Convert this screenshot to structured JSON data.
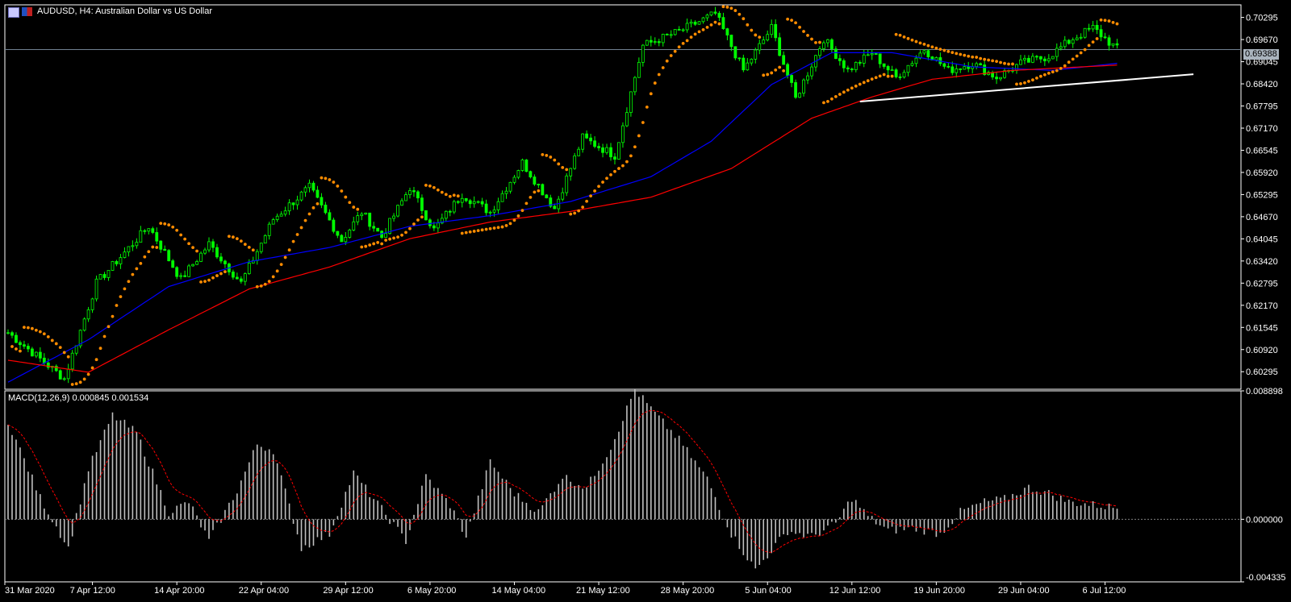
{
  "header": {
    "symbol_line": "AUDUSD, H4:  Australian Dollar vs US Dollar",
    "icons": [
      "chart-window-icon",
      "flag-icon"
    ]
  },
  "macd_label": "MACD(12,26,9) 0.000845 0.001534",
  "current_price": "0.69388",
  "colors": {
    "background": "#000000",
    "grid": "#ffffff",
    "candle_up": "#00ff00",
    "candle_down": "#00ff00",
    "ma_fast": "#0000ff",
    "ma_slow": "#ff0000",
    "sar": "#ff8c00",
    "trendline": "#ffffff",
    "macd_hist": "#c0c0c0",
    "macd_signal": "#ff0000",
    "price_line": "#708090"
  },
  "chart_data": [
    {
      "type": "candlestick",
      "title": "AUDUSD, H4:  Australian Dollar vs US Dollar",
      "ylim": [
        0.598,
        0.7065
      ],
      "y_ticks": [
        "0.70295",
        "0.69670",
        "0.69045",
        "0.68420",
        "0.67795",
        "0.67170",
        "0.66545",
        "0.65920",
        "0.65295",
        "0.64670",
        "0.64045",
        "0.63420",
        "0.62795",
        "0.62170",
        "0.61545",
        "0.60920",
        "0.60295"
      ],
      "x_ticks": [
        "31 Mar 2020",
        "7 Apr 12:00",
        "14 Apr 20:00",
        "22 Apr 04:00",
        "29 Apr 12:00",
        "6 May 20:00",
        "14 May 04:00",
        "21 May 12:00",
        "28 May 20:00",
        "5 Jun 04:00",
        "12 Jun 12:00",
        "19 Jun 20:00",
        "29 Jun 04:00",
        "6 Jul 12:00"
      ],
      "bars": 277,
      "close_path_anchors": {
        "bar_index": [
          0,
          14,
          22,
          35,
          43,
          50,
          58,
          66,
          75,
          83,
          88,
          93,
          100,
          106,
          113,
          120,
          128,
          136,
          143,
          151,
          158,
          167,
          176,
          183,
          190,
          196,
          203,
          209,
          215,
          221,
          228,
          234,
          240,
          246,
          252,
          259,
          265,
          270,
          276
        ],
        "close": [
          0.614,
          0.601,
          0.628,
          0.644,
          0.629,
          0.639,
          0.628,
          0.646,
          0.655,
          0.64,
          0.648,
          0.641,
          0.655,
          0.643,
          0.653,
          0.648,
          0.662,
          0.649,
          0.669,
          0.664,
          0.695,
          0.699,
          0.704,
          0.688,
          0.7,
          0.68,
          0.697,
          0.688,
          0.693,
          0.686,
          0.694,
          0.688,
          0.69,
          0.686,
          0.69,
          0.692,
          0.697,
          0.7,
          0.694
        ]
      },
      "ma_fast_anchors": {
        "bar_index": [
          0,
          20,
          40,
          60,
          80,
          100,
          120,
          140,
          160,
          175,
          190,
          205,
          220,
          240,
          260,
          276
        ],
        "value": [
          0.6,
          0.612,
          0.627,
          0.634,
          0.638,
          0.644,
          0.647,
          0.651,
          0.658,
          0.668,
          0.684,
          0.693,
          0.693,
          0.689,
          0.688,
          0.69
        ]
      },
      "ma_slow_anchors": {
        "bar_index": [
          0,
          20,
          40,
          60,
          80,
          100,
          120,
          140,
          160,
          180,
          200,
          215,
          230,
          250,
          276
        ],
        "value": [
          0.6062,
          0.6028,
          0.6148,
          0.6263,
          0.6325,
          0.6405,
          0.6452,
          0.6482,
          0.6522,
          0.6603,
          0.6745,
          0.6805,
          0.6855,
          0.688,
          0.6895
        ]
      },
      "trendline": {
        "from": {
          "bar": 212,
          "price": 0.6792
        },
        "to": {
          "bar": 295,
          "price": 0.6869
        }
      },
      "sar_note": "Parabolic SAR dots plotted above and below price"
    },
    {
      "type": "bar",
      "title": "MACD(12,26,9) 0.000845 0.001534",
      "ylim": [
        -0.004335,
        0.008898
      ],
      "y_ticks": [
        "0.008898",
        "0.000000",
        "-0.004335"
      ],
      "macd_values": 0.000845,
      "signal_value": 0.001534,
      "hist_anchors": {
        "bar_index": [
          0,
          8,
          15,
          20,
          26,
          32,
          40,
          45,
          50,
          57,
          62,
          66,
          73,
          80,
          86,
          93,
          99,
          104,
          110,
          114,
          120,
          126,
          132,
          138,
          144,
          150,
          156,
          162,
          167,
          174,
          180,
          186,
          194,
          200,
          206,
          210,
          214,
          219,
          225,
          232,
          237,
          243,
          248,
          254,
          259,
          264,
          270,
          276
        ],
        "value": [
          0.0068,
          0.0015,
          -0.002,
          0.0035,
          0.0072,
          0.006,
          0.0005,
          0.0012,
          -0.0015,
          0.002,
          0.0052,
          0.0048,
          -0.002,
          -0.001,
          0.0032,
          0.0007,
          -0.0015,
          0.003,
          0.001,
          -0.0012,
          0.004,
          0.0018,
          0.0005,
          0.003,
          0.0022,
          0.005,
          0.009,
          0.007,
          0.0055,
          0.0028,
          -0.001,
          -0.0035,
          -0.0008,
          -0.0012,
          -0.0003,
          0.0015,
          0.0002,
          -0.0008,
          -0.0006,
          -0.001,
          0.0005,
          0.0012,
          0.0014,
          0.0022,
          0.0018,
          0.0012,
          0.001,
          0.0008
        ]
      }
    }
  ]
}
